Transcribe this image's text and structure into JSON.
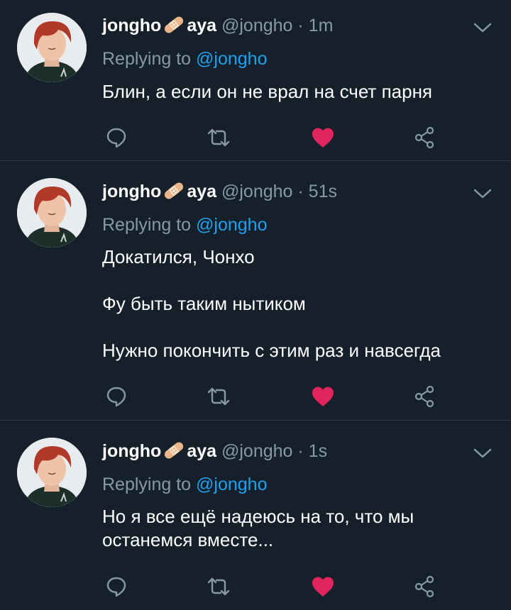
{
  "tweets": [
    {
      "name_pre": "jongho",
      "name_post": "aya",
      "handle": "@jongho",
      "dot": "·",
      "time": "1m",
      "replying_prefix": "Replying to ",
      "replying_to": "@jongho",
      "lines": [
        "Блин,  а если он не врал на счет парня"
      ],
      "liked": true
    },
    {
      "name_pre": "jongho",
      "name_post": "aya",
      "handle": "@jongho",
      "dot": "·",
      "time": "51s",
      "replying_prefix": "Replying to ",
      "replying_to": "@jongho",
      "lines": [
        "Докатился, Чонхо",
        "Фу быть таким нытиком",
        "Нужно покончить с этим раз и навсегда"
      ],
      "liked": true
    },
    {
      "name_pre": "jongho",
      "name_post": "aya",
      "handle": "@jongho",
      "dot": "·",
      "time": "1s",
      "replying_prefix": "Replying to ",
      "replying_to": "@jongho",
      "lines": [
        "Но я все ещё надеюсь на то, что мы останемся вместе..."
      ],
      "liked": true
    }
  ],
  "icons": [
    "bandage-icon",
    "chevron-down-icon",
    "reply-icon",
    "retweet-icon",
    "heart-icon",
    "share-icon"
  ],
  "colors": {
    "background": "#15202b",
    "secondary_text": "#8899a6",
    "link": "#1da1f2",
    "like": "#e0245e",
    "divider": "#2c3a47"
  }
}
